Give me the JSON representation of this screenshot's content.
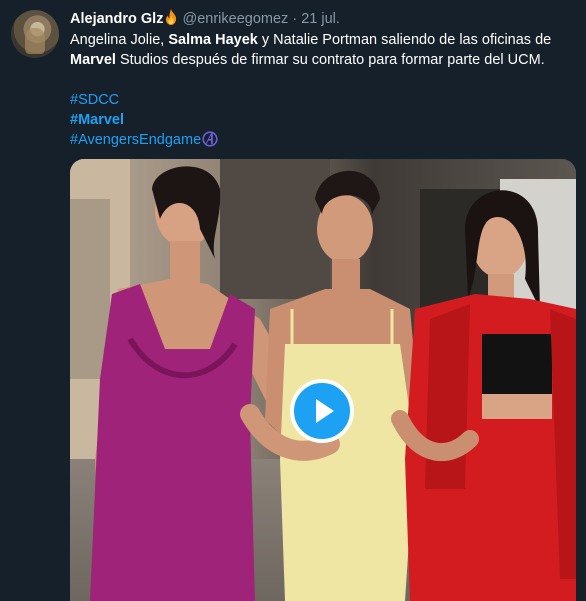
{
  "tweet": {
    "author_name": "Alejandro Glz",
    "author_handle": "@enrikeegomez",
    "separator": "·",
    "date": "21 jul.",
    "text_part1": "Angelina Jolie, ",
    "text_bold1": "Salma Hayek",
    "text_part2": " y Natalie Portman saliendo de las oficinas de ",
    "text_bold2": "Marvel",
    "text_part3": " Studios después de firmar su contrato para formar parte del UCM.",
    "hashtags": [
      {
        "text": "#SDCC"
      },
      {
        "text": "#Marvel"
      },
      {
        "text": "#AvengersEndgame"
      }
    ]
  },
  "icons": {
    "author_emoji": "fire-icon",
    "hashtag_emoji": "avengers-logo-icon",
    "media_control": "play-icon"
  },
  "colors": {
    "background": "#15202b",
    "link": "#1da1f2",
    "secondary_text": "#8899a6",
    "play_button": "#1da1f2"
  }
}
